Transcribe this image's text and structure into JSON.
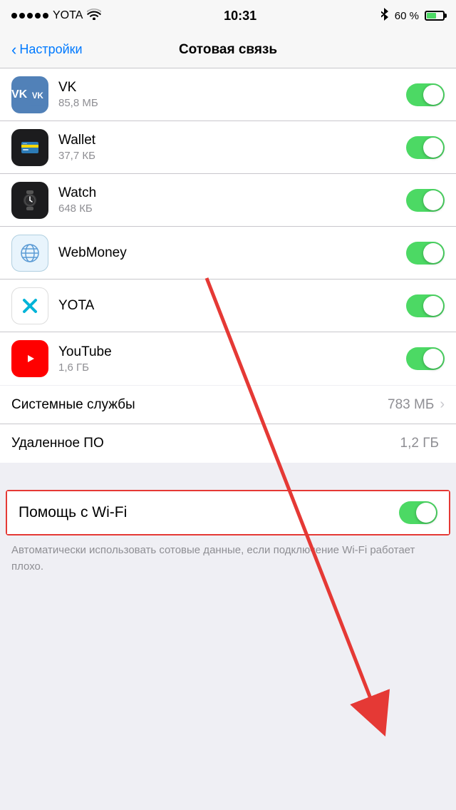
{
  "statusBar": {
    "carrier": "YOTA",
    "time": "10:31",
    "battery_percent": "60 %"
  },
  "navBar": {
    "back_label": "Настройки",
    "title": "Сотовая связь"
  },
  "apps": [
    {
      "name": "VK",
      "size": "85,8 МБ",
      "icon_type": "vk",
      "toggle_on": true
    },
    {
      "name": "Wallet",
      "size": "37,7 КБ",
      "icon_type": "wallet",
      "toggle_on": true
    },
    {
      "name": "Watch",
      "size": "648 КБ",
      "icon_type": "watch",
      "toggle_on": true
    },
    {
      "name": "WebMoney",
      "size": "",
      "icon_type": "webmoney",
      "toggle_on": true
    },
    {
      "name": "YOTA",
      "size": "",
      "icon_type": "yota",
      "toggle_on": true
    },
    {
      "name": "YouTube",
      "size": "1,6 ГБ",
      "icon_type": "youtube",
      "toggle_on": true
    }
  ],
  "systemItems": [
    {
      "label": "Системные службы",
      "value": "783 МБ",
      "has_chevron": true
    },
    {
      "label": "Удаленное ПО",
      "value": "1,2 ГБ",
      "has_chevron": false
    }
  ],
  "wifiHelp": {
    "label": "Помощь с Wi-Fi",
    "toggle_on": true,
    "description": "Автоматически использовать сотовые данные, если подключение Wi-Fi работает плохо."
  }
}
